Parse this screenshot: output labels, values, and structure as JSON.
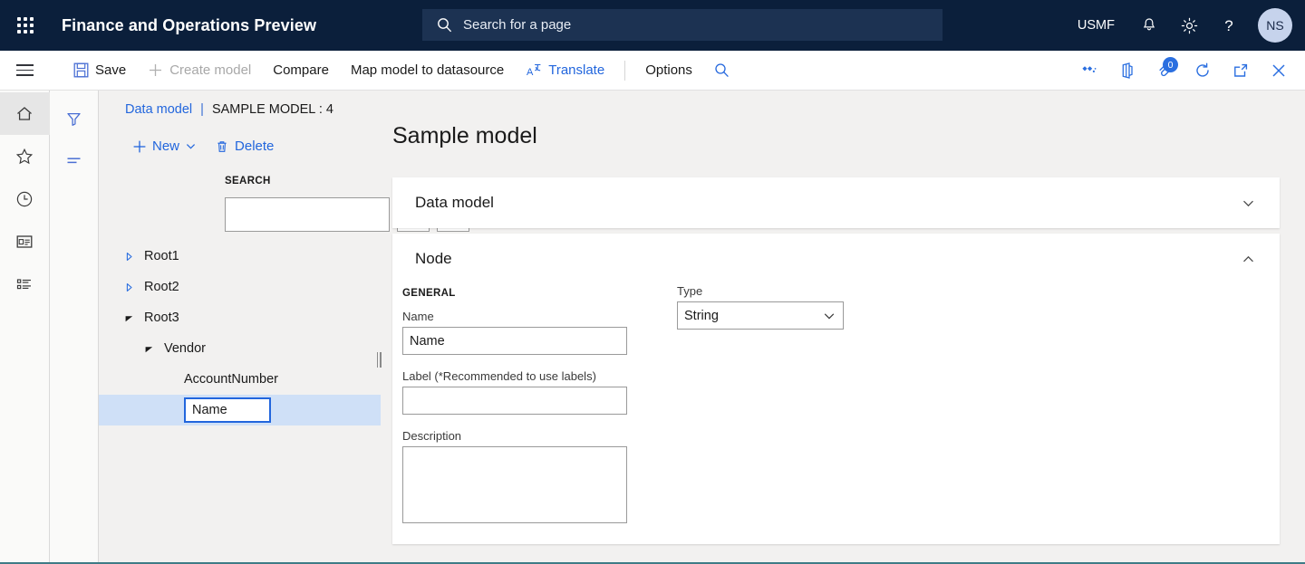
{
  "header": {
    "waffle_icon": "app-launcher-icon",
    "app_title": "Finance and Operations Preview",
    "search": {
      "icon": "search-icon",
      "placeholder": "Search for a page",
      "value": ""
    },
    "company": "USMF",
    "icons": [
      {
        "name": "notifications-bell-icon",
        "glyph": "bell"
      },
      {
        "name": "settings-gear-icon",
        "glyph": "gear"
      },
      {
        "name": "help-question-icon",
        "glyph": "question"
      }
    ],
    "avatar_initials": "NS"
  },
  "commandbar": {
    "hamburger_icon": "hamburger-menu-icon",
    "buttons": [
      {
        "label": "Save",
        "icon": "save-disk-icon",
        "state": "enabled",
        "accent": false
      },
      {
        "label": "Create model",
        "icon": "plus-icon",
        "state": "disabled",
        "accent": false
      },
      {
        "label": "Compare",
        "icon": "",
        "state": "enabled",
        "accent": false
      },
      {
        "label": "Map model to datasource",
        "icon": "",
        "state": "enabled",
        "accent": false
      },
      {
        "label": "Translate",
        "icon": "translate-icon",
        "state": "enabled",
        "accent": true
      }
    ],
    "options_label": "Options",
    "filter_search_icon": "search-icon",
    "right_icons": [
      {
        "name": "shapes-diamond-icon",
        "badge": null
      },
      {
        "name": "office-app-icon",
        "badge": null
      },
      {
        "name": "attachments-icon",
        "badge": "0"
      },
      {
        "name": "refresh-icon",
        "badge": null
      },
      {
        "name": "open-in-new-window-icon",
        "badge": null
      },
      {
        "name": "close-icon",
        "badge": null
      }
    ]
  },
  "navrail": {
    "items": [
      {
        "name": "nav-home",
        "icon": "home-icon",
        "active": true
      },
      {
        "name": "nav-favorites",
        "icon": "star-icon",
        "active": false
      },
      {
        "name": "nav-recent",
        "icon": "clock-icon",
        "active": false
      },
      {
        "name": "nav-workspaces",
        "icon": "workspace-icon",
        "active": false
      },
      {
        "name": "nav-modules",
        "icon": "list-icon",
        "active": false
      }
    ]
  },
  "navrail2": {
    "items": [
      {
        "name": "filter-pane-toggle",
        "icon": "filter-funnel-icon"
      },
      {
        "name": "list-pane-toggle",
        "icon": "sort-lines-icon"
      }
    ]
  },
  "treepane": {
    "breadcrumb": {
      "link": "Data model",
      "divider": "|",
      "current": "SAMPLE MODEL : 4"
    },
    "actions": {
      "new_label": "New",
      "new_icon": "plus-icon",
      "new_chevron_icon": "chevron-down-icon",
      "delete_label": "Delete",
      "delete_icon": "trash-icon"
    },
    "search_label": "SEARCH",
    "search_value": "",
    "search_placeholder": "",
    "prev_icon": "chevron-up-icon",
    "next_icon": "chevron-down-icon",
    "nodes": [
      {
        "label": "Root1",
        "depth": 0,
        "twisty": "collapsed",
        "selected": false,
        "editing": false
      },
      {
        "label": "Root2",
        "depth": 0,
        "twisty": "collapsed",
        "selected": false,
        "editing": false
      },
      {
        "label": "Root3",
        "depth": 0,
        "twisty": "expanded",
        "selected": false,
        "editing": false
      },
      {
        "label": "Vendor",
        "depth": 1,
        "twisty": "expanded",
        "selected": false,
        "editing": false
      },
      {
        "label": "AccountNumber",
        "depth": 2,
        "twisty": "none",
        "selected": false,
        "editing": false
      },
      {
        "label": "Name",
        "depth": 2,
        "twisty": "none",
        "selected": true,
        "editing": true
      }
    ],
    "splitter_name": "pane-splitter"
  },
  "detail": {
    "page_title": "Sample model",
    "cards": [
      {
        "title": "Data model",
        "expanded": false,
        "chevron": "chevron-down-icon"
      },
      {
        "title": "Node",
        "expanded": true,
        "chevron": "chevron-up-icon"
      }
    ],
    "general_group_label": "GENERAL",
    "fields": {
      "name": {
        "label": "Name",
        "value": "Name",
        "placeholder": ""
      },
      "label": {
        "label": "Label (*Recommended to use labels)",
        "value": "",
        "placeholder": ""
      },
      "description": {
        "label": "Description",
        "value": "",
        "placeholder": ""
      },
      "type": {
        "label": "Type",
        "value": "String",
        "chevron": "chevron-down-icon"
      }
    }
  },
  "colors": {
    "header_bg": "#0b1f3b",
    "header_search_bg": "#1c3252",
    "accent_blue": "#2266dd",
    "selection_blue": "#cfe0f7",
    "workspace_bg": "#f2f1f0",
    "bottom_bar": "#3f7b86"
  }
}
